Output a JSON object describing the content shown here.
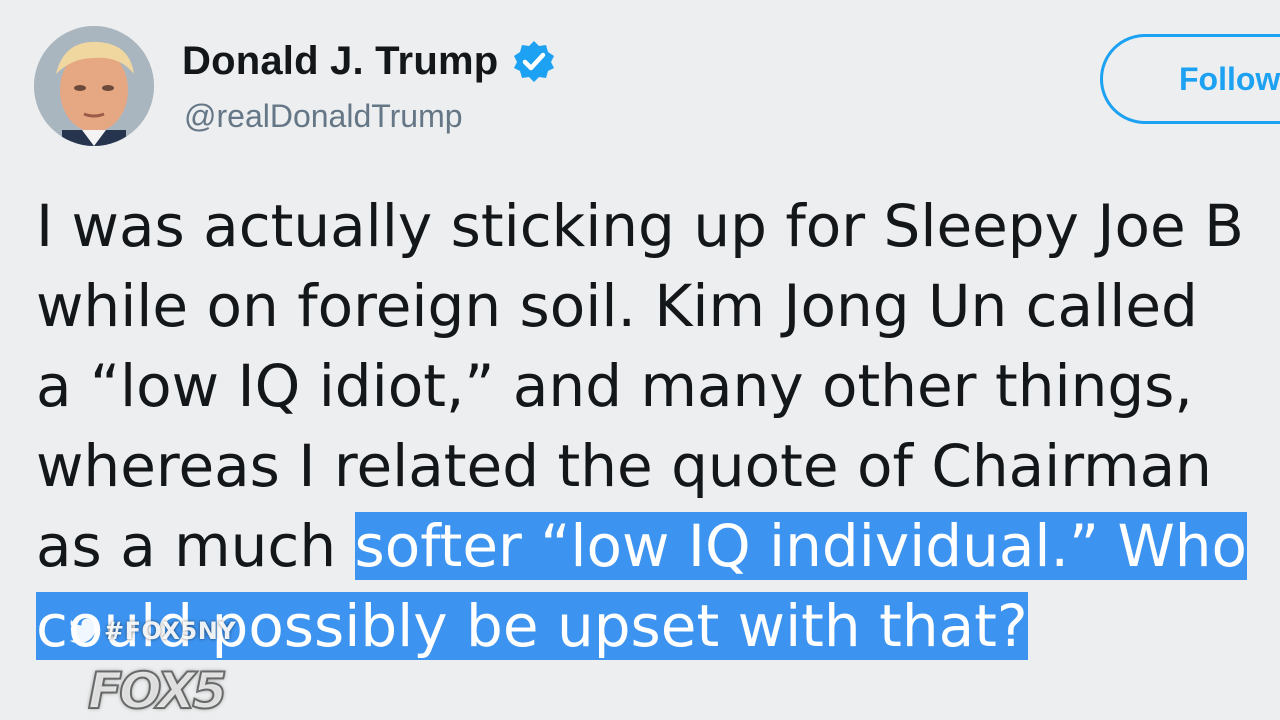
{
  "tweet": {
    "author": {
      "display_name": "Donald J. Trump",
      "handle": "@realDonaldTrump",
      "verified": true,
      "avatar_icon": "profile-photo"
    },
    "follow_label": "Follow",
    "lines": [
      {
        "plain": "I was actually sticking up for Sleepy Joe B",
        "highlight": ""
      },
      {
        "plain": "while on foreign soil. Kim Jong Un called",
        "highlight": ""
      },
      {
        "plain": "a “low IQ idiot,” and many other things,",
        "highlight": ""
      },
      {
        "plain": "whereas I related the quote of Chairman",
        "highlight": ""
      },
      {
        "plain": "as a much ",
        "highlight": "softer “low IQ individual.” Who"
      },
      {
        "plain": "",
        "highlight": "could possibly be upset with that?"
      }
    ]
  },
  "broadcast_overlay": {
    "hashtag": "#FOX5NY",
    "hashtag_icon": "twitter-bird-icon",
    "logo_text": "FOX5"
  },
  "colors": {
    "background": "#eceeef",
    "text": "#14171a",
    "secondary_text": "#657786",
    "accent": "#1da1f2",
    "highlight": "#3d94f0"
  }
}
